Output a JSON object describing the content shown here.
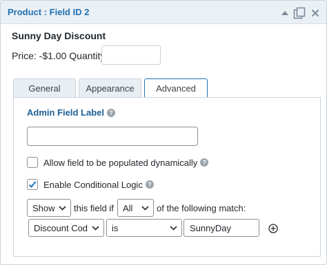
{
  "header": {
    "title": "Product : Field ID 2",
    "icons": [
      "collapse-arrow-icon",
      "duplicate-icon",
      "close-icon"
    ]
  },
  "field": {
    "name": "Sunny Day Discount",
    "price_text": "Price: -$1.00",
    "quantity_label": "Quantity:",
    "quantity_value": ""
  },
  "tabs": [
    {
      "label": "General",
      "active": false
    },
    {
      "label": "Appearance",
      "active": false
    },
    {
      "label": "Advanced",
      "active": true
    }
  ],
  "advanced": {
    "admin_label": "Admin Field Label",
    "admin_value": "",
    "allow_dynamic": {
      "label": "Allow field to be populated dynamically",
      "checked": false
    },
    "conditional": {
      "label": "Enable Conditional Logic",
      "checked": true
    },
    "logic": {
      "action": "Show",
      "this_field_if": "this field if",
      "match": "All",
      "of_following": "of the following match:",
      "rule": {
        "field": "Discount Cod",
        "operator": "is",
        "value": "SunnyDay"
      }
    }
  },
  "colors": {
    "accent": "#2271b1",
    "header_bg": "#ebf0f5",
    "tab_bg": "#e9eef3"
  }
}
